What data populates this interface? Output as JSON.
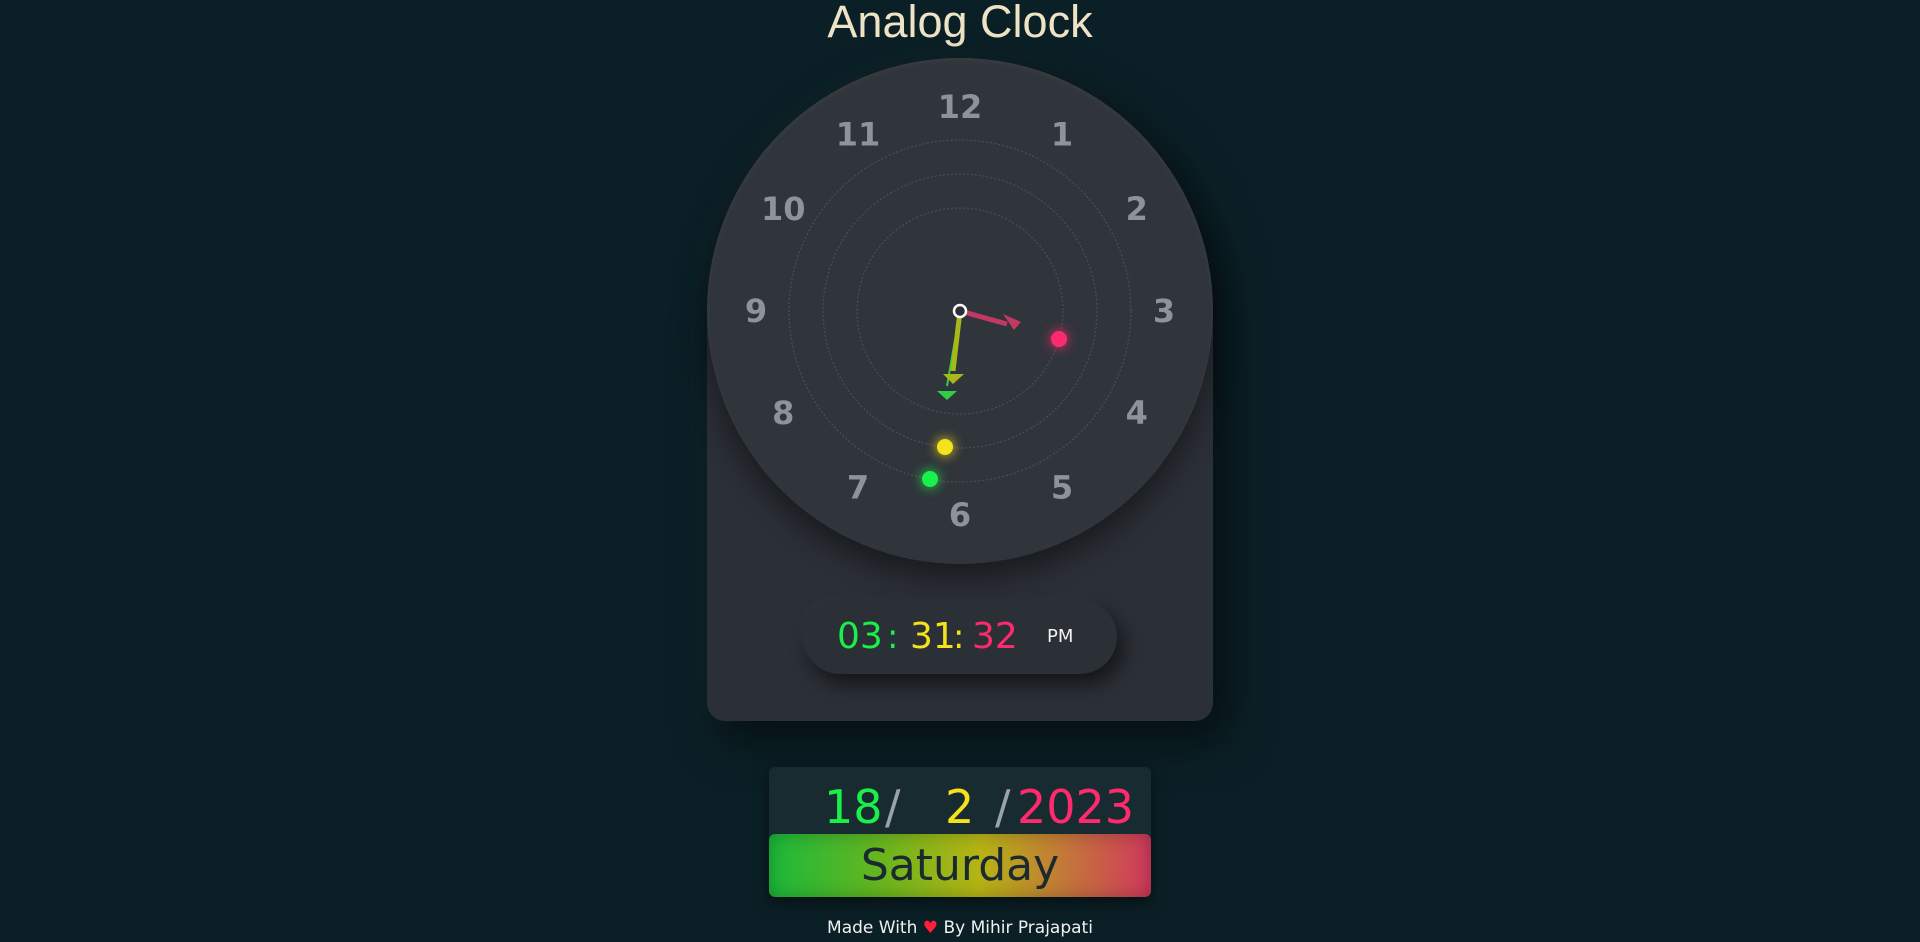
{
  "page": {
    "title": "Analog Clock",
    "background_color": "#0b2026"
  },
  "analog_clock": {
    "numerals": [
      "12",
      "1",
      "2",
      "3",
      "4",
      "5",
      "6",
      "7",
      "8",
      "9",
      "10",
      "11"
    ],
    "hands": {
      "hour": {
        "value": "03",
        "color": "#c23a62"
      },
      "minute": {
        "value": "31",
        "color": "#a8b81a"
      },
      "second": {
        "value": "32",
        "color": "#2ecf45"
      }
    },
    "indicator_dots": [
      {
        "name": "hour",
        "color": "#ff2a6d"
      },
      {
        "name": "minute",
        "color": "#f5e21a"
      },
      {
        "name": "second",
        "color": "#1af04a"
      }
    ]
  },
  "digital_clock": {
    "hours": "03",
    "separator": ":",
    "minutes": "31",
    "seconds": "32",
    "ampm": "PM"
  },
  "date": {
    "day": "18",
    "separator": "/",
    "month": "2",
    "year": "2023",
    "weekday": "Saturday"
  },
  "footer": {
    "prefix": "Made With",
    "heart_icon": "♥",
    "suffix": "By Mihir Prajapati"
  }
}
